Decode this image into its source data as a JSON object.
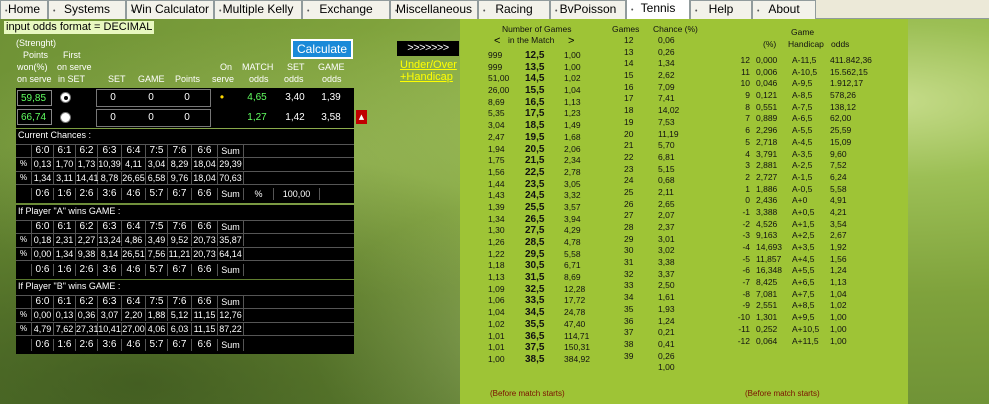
{
  "tabs": [
    "Home",
    "Systems",
    "Win Calculator",
    "Multiple Kelly",
    "Exchange",
    "Miscellaneous",
    "Racing",
    "BvPoisson",
    "Tennis",
    "Help",
    "About"
  ],
  "odds_format": "input odds format = DECIMAL",
  "calculate_label": "Calculate",
  "strength_label": "(Strenght)",
  "col_points_first": "Points",
  "col_first": "First",
  "col_won": "won(%)",
  "col_on_serve": "on serve",
  "col_on_serve2": "on serve",
  "col_in_set": "in SET",
  "col_set": "SET",
  "col_game": "GAME",
  "col_points": "Points",
  "col_on": "On",
  "col_serve": "serve",
  "col_match": "MATCH",
  "col_odds": "odds",
  "col_set_odds": "SET",
  "col_set_odds2": "odds",
  "col_game_odds": "GAME",
  "col_game_odds2": "odds",
  "player_a": {
    "points": "59,85",
    "set": "0",
    "game": "0",
    "pts": "0",
    "serve": "•",
    "match": "4,65",
    "set_odds": "3,40",
    "game_odds": "1,39"
  },
  "player_b": {
    "points": "66,74",
    "set": "0",
    "game": "0",
    "pts": "0",
    "serve": "",
    "match": "1,27",
    "set_odds": "1,42",
    "game_odds": "3,58"
  },
  "current_title": "Current Chances :",
  "current_hdr": [
    "6:0",
    "6:1",
    "6:2",
    "6:3",
    "6:4",
    "7:5",
    "7:6",
    "6:6",
    "Sum"
  ],
  "current_a": [
    "0,13",
    "1,70",
    "1,73",
    "10,39",
    "4,11",
    "3,04",
    "8,29",
    "18,04",
    "29,39"
  ],
  "current_b": [
    "1,34",
    "3,11",
    "14,41",
    "8,78",
    "26,65",
    "6,58",
    "9,76",
    "18,04",
    "70,63"
  ],
  "current_ftr": [
    "0:6",
    "1:6",
    "2:6",
    "3:6",
    "4:6",
    "5:7",
    "6:7",
    "6:6",
    "Sum",
    "%",
    "100,00"
  ],
  "a_title": "If Player \"A\" wins GAME :",
  "a_hdr": [
    "6:0",
    "6:1",
    "6:2",
    "6:3",
    "6:4",
    "7:5",
    "7:6",
    "6:6",
    "Sum"
  ],
  "a_a": [
    "0,18",
    "2,31",
    "2,27",
    "13,24",
    "4,86",
    "3,49",
    "9,52",
    "20,73",
    "35,87"
  ],
  "a_b": [
    "0,00",
    "1,34",
    "9,38",
    "8,14",
    "26,51",
    "7,56",
    "11,21",
    "20,73",
    "64,14"
  ],
  "a_ftr": [
    "0:6",
    "1:6",
    "2:6",
    "3:6",
    "4:6",
    "5:7",
    "6:7",
    "6:6",
    "Sum"
  ],
  "b_title": "If Player \"B\" wins GAME :",
  "b_hdr": [
    "6:0",
    "6:1",
    "6:2",
    "6:3",
    "6:4",
    "7:5",
    "7:6",
    "6:6",
    "Sum"
  ],
  "b_a": [
    "0,00",
    "0,13",
    "0,36",
    "3,07",
    "2,20",
    "1,88",
    "5,12",
    "11,15",
    "12,76"
  ],
  "b_b": [
    "4,79",
    "7,62",
    "27,31",
    "10,41",
    "27,00",
    "4,06",
    "6,03",
    "11,15",
    "87,22"
  ],
  "b_ftr": [
    "0:6",
    "1:6",
    "2:6",
    "3:6",
    "4:6",
    "5:7",
    "6:7",
    "6:6",
    "Sum"
  ],
  "pct_sign": "%",
  "arrows": ">>>>>>>",
  "under_over": "Under/Over",
  "plus_handicap": "+Handicap",
  "num_games_title": "Number of Games",
  "in_match": "in the Match",
  "nav_left": "<",
  "nav_right": ">",
  "games_hdr": "Games",
  "chance_hdr": "Chance (%)",
  "uo_odds1": [
    "999",
    "999",
    "51,00",
    "26,00",
    "8,69",
    "5,35",
    "3,04",
    "2,47",
    "1,94",
    "1,75",
    "1,56",
    "1,44",
    "1,43",
    "1,39",
    "1,34",
    "1,30",
    "1,26",
    "1,22",
    "1,18",
    "1,13",
    "1,09",
    "1,06",
    "1,04",
    "1,02",
    "1,01",
    "1,01",
    "1,00"
  ],
  "uo_line": [
    "12,5",
    "13,5",
    "14,5",
    "15,5",
    "16,5",
    "17,5",
    "18,5",
    "19,5",
    "20,5",
    "21,5",
    "22,5",
    "23,5",
    "24,5",
    "25,5",
    "26,5",
    "27,5",
    "28,5",
    "29,5",
    "30,5",
    "31,5",
    "32,5",
    "33,5",
    "34,5",
    "35,5",
    "36,5",
    "37,5",
    "38,5"
  ],
  "uo_odds2": [
    "1,00",
    "1,00",
    "1,02",
    "1,04",
    "1,13",
    "1,23",
    "1,49",
    "1,68",
    "2,06",
    "2,34",
    "2,78",
    "3,05",
    "3,32",
    "3,57",
    "3,94",
    "4,29",
    "4,78",
    "5,58",
    "6,71",
    "8,69",
    "12,28",
    "17,72",
    "24,78",
    "47,40",
    "114,71",
    "150,31",
    "384,92"
  ],
  "games": [
    "12",
    "13",
    "14",
    "15",
    "16",
    "17",
    "18",
    "19",
    "20",
    "21",
    "22",
    "23",
    "24",
    "25",
    "26",
    "27",
    "28",
    "29",
    "30",
    "31",
    "32",
    "33",
    "34",
    "35",
    "36",
    "37",
    "38",
    "39"
  ],
  "chance": [
    "0,06",
    "0,26",
    "1,34",
    "2,62",
    "7,09",
    "7,41",
    "14,02",
    "7,53",
    "11,19",
    "5,70",
    "6,81",
    "5,15",
    "0,68",
    "2,11",
    "2,65",
    "2,07",
    "2,37",
    "3,01",
    "3,02",
    "3,38",
    "3,37",
    "2,50",
    "1,61",
    "1,93",
    "1,24",
    "0,21",
    "0,41",
    "0,26",
    "1,00"
  ],
  "hc_title": "Game",
  "hc_pct": "(%)",
  "hc_handicap": "Handicap",
  "hc_odds": "odds",
  "hc_n": [
    "12",
    "11",
    "10",
    "9",
    "8",
    "7",
    "6",
    "5",
    "4",
    "3",
    "2",
    "1",
    "0",
    "-1",
    "-2",
    "-3",
    "-4",
    "-5",
    "-6",
    "-7",
    "-8",
    "-9",
    "-10",
    "-11",
    "-12"
  ],
  "hc_p": [
    "0,000",
    "0,006",
    "0,046",
    "0,121",
    "0,551",
    "0,889",
    "2,296",
    "2,718",
    "3,791",
    "2,881",
    "2,727",
    "1,886",
    "2,436",
    "3,388",
    "4,526",
    "9,163",
    "14,693",
    "11,857",
    "16,348",
    "8,425",
    "7,081",
    "2,551",
    "1,301",
    "0,252",
    "0,064"
  ],
  "hc_h": [
    "A-11,5",
    "A-10,5",
    "A-9,5",
    "A-8,5",
    "A-7,5",
    "A-6,5",
    "A-5,5",
    "A-4,5",
    "A-3,5",
    "A-2,5",
    "A-1,5",
    "A-0,5",
    "A+0",
    "A+0,5",
    "A+1,5",
    "A+2,5",
    "A+3,5",
    "A+4,5",
    "A+5,5",
    "A+6,5",
    "A+7,5",
    "A+8,5",
    "A+9,5",
    "A+10,5",
    "A+11,5"
  ],
  "hc_o": [
    "411.842,36",
    "15.562,15",
    "1.912,17",
    "578,26",
    "138,12",
    "62,00",
    "25,59",
    "15,09",
    "9,60",
    "7,52",
    "6,24",
    "5,58",
    "4,91",
    "4,21",
    "3,54",
    "2,67",
    "1,92",
    "1,56",
    "1,24",
    "1,13",
    "1,04",
    "1,02",
    "1,00",
    "1,00",
    "1,00"
  ],
  "before1": "(Before match starts)",
  "before2": "(Before match starts)"
}
